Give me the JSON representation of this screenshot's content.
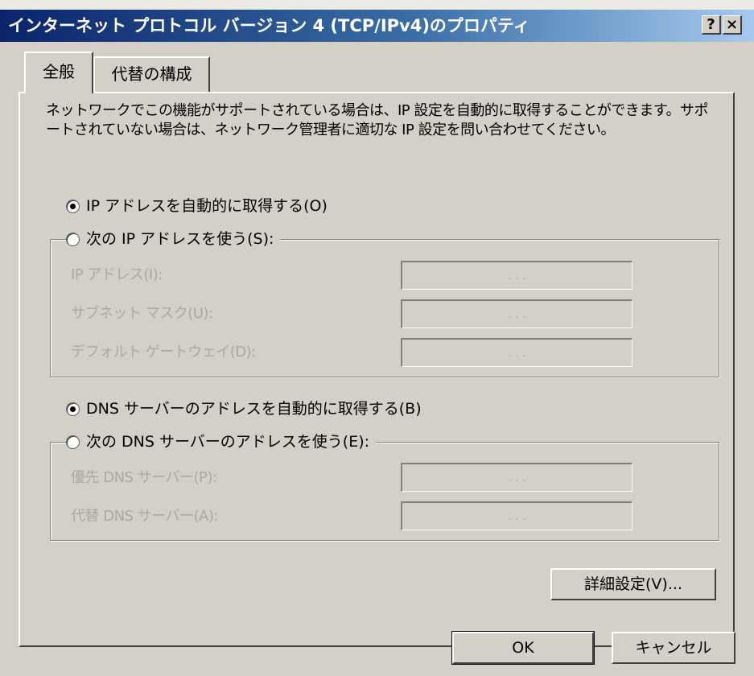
{
  "window": {
    "title": "インターネット プロトコル バージョン 4 (TCP/IPv4)のプロパティ",
    "help_btn": "?",
    "close_btn": "×"
  },
  "tabs": [
    {
      "label": "全般",
      "active": true
    },
    {
      "label": "代替の構成",
      "active": false
    }
  ],
  "description": "ネットワークでこの機能がサポートされている場合は、IP 設定を自動的に取得することができます。サポートされていない場合は、ネットワーク管理者に適切な IP 設定を問い合わせてください。",
  "ip": {
    "auto_label": "IP アドレスを自動的に取得する(O)",
    "auto_selected": true,
    "manual_label": "次の IP アドレスを使う(S):",
    "fields": [
      {
        "label": "IP アドレス(I):",
        "value": ". . ."
      },
      {
        "label": "サブネット マスク(U):",
        "value": ". . ."
      },
      {
        "label": "デフォルト ゲートウェイ(D):",
        "value": ". . ."
      }
    ]
  },
  "dns": {
    "auto_label": "DNS サーバーのアドレスを自動的に取得する(B)",
    "auto_selected": true,
    "manual_label": "次の DNS サーバーのアドレスを使う(E):",
    "fields": [
      {
        "label": "優先 DNS サーバー(P):",
        "value": ". . ."
      },
      {
        "label": "代替 DNS サーバー(A):",
        "value": ". . ."
      }
    ]
  },
  "buttons": {
    "advanced": "詳細設定(V)...",
    "ok": "OK",
    "cancel": "キャンセル"
  }
}
